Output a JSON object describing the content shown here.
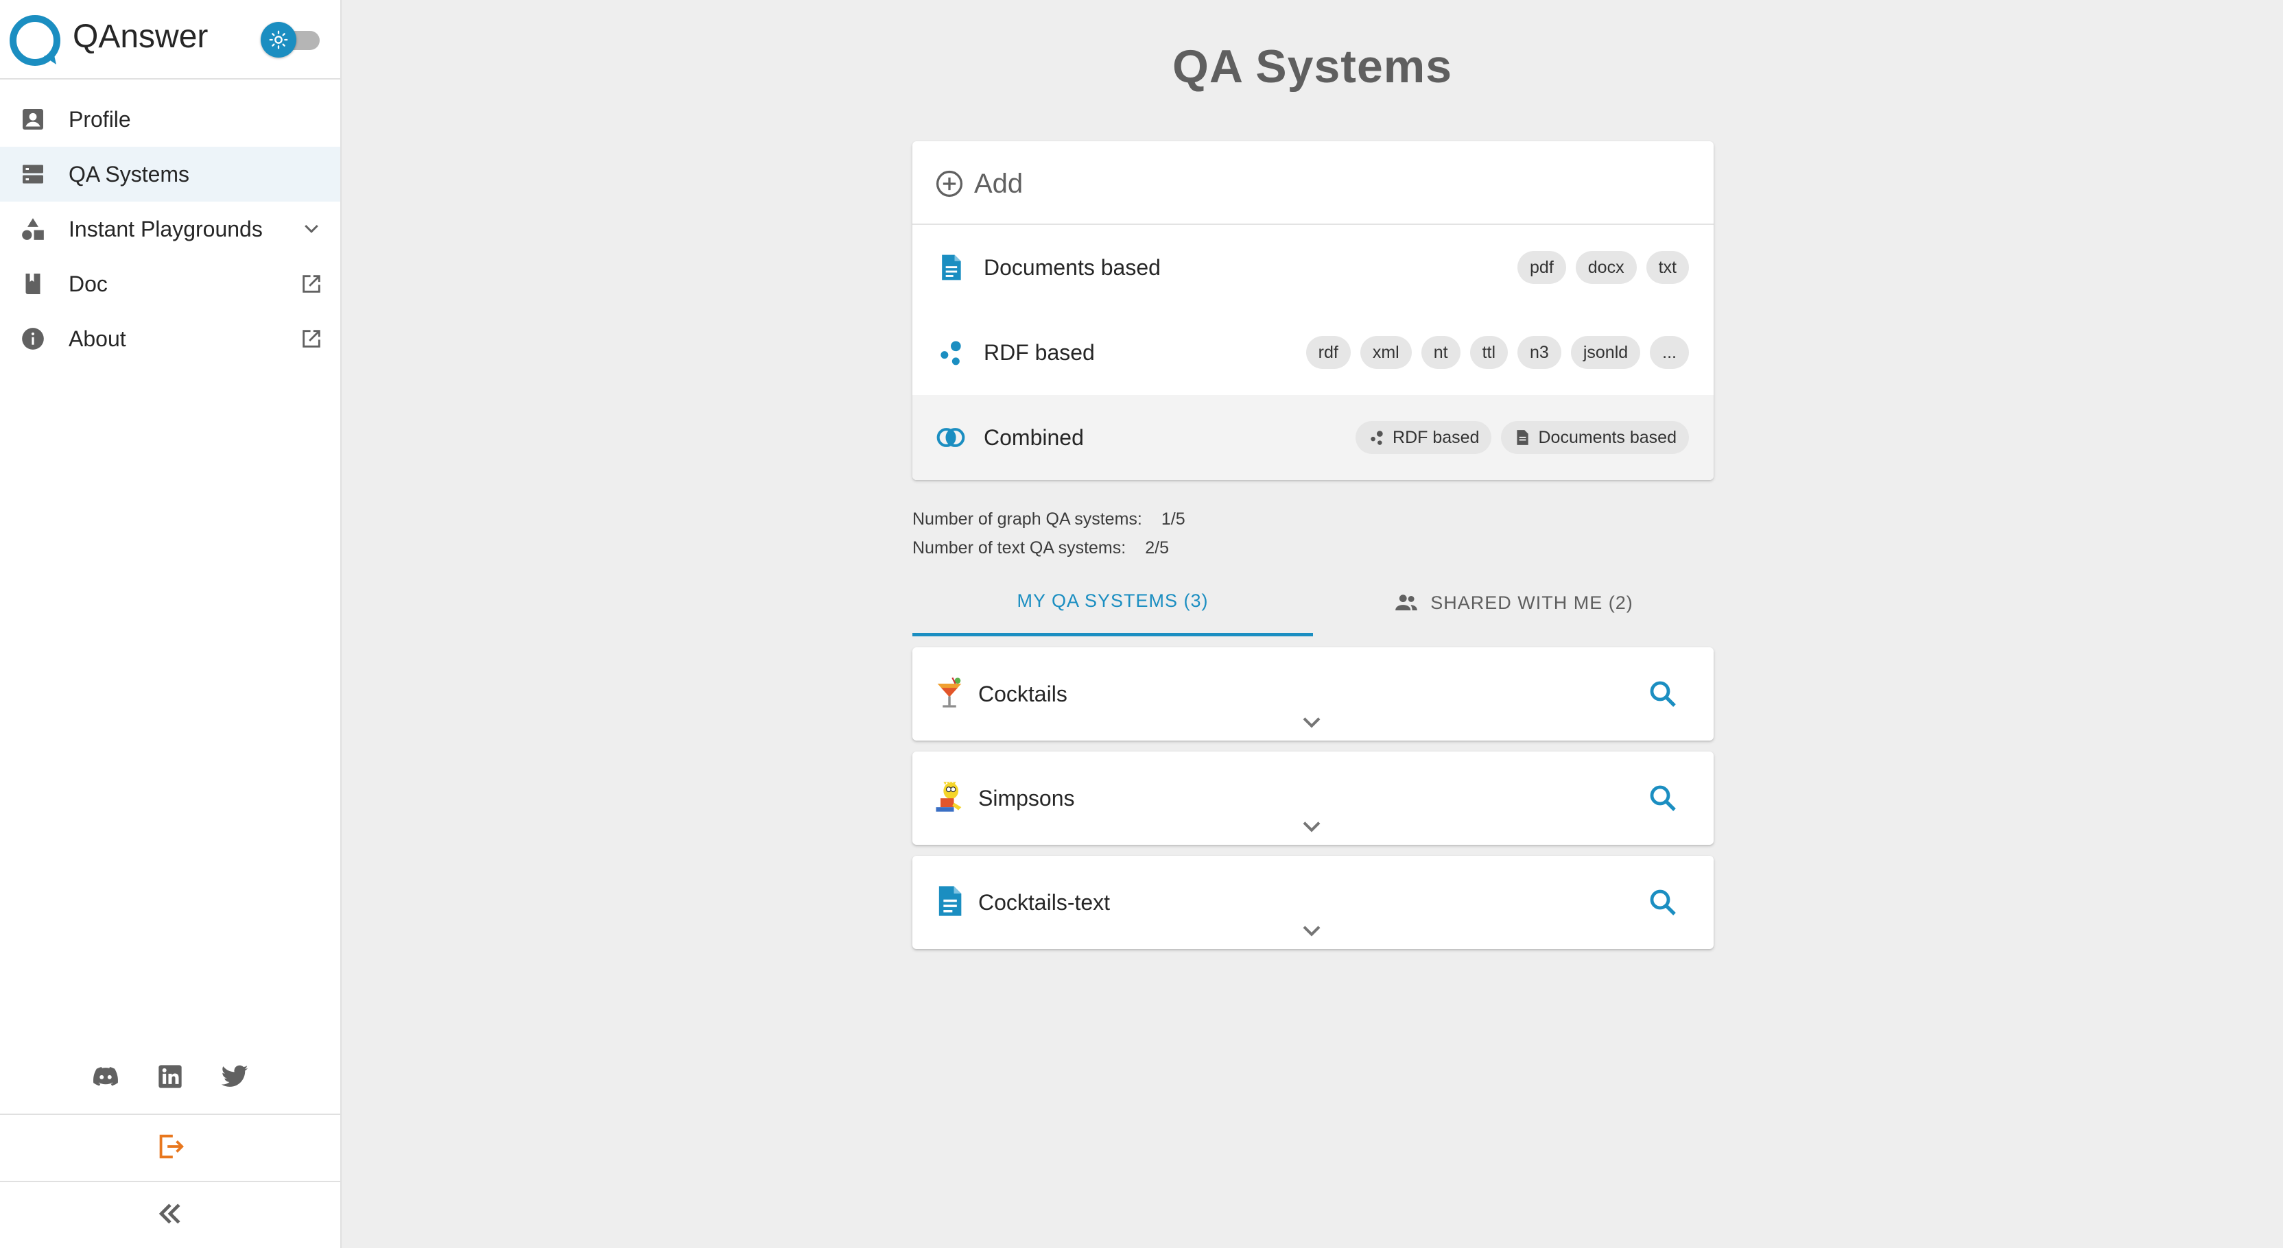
{
  "app": {
    "name": "QAnswer"
  },
  "colors": {
    "accent": "#1b8ec1",
    "logout": "#e8771e",
    "icon_gray": "#616161"
  },
  "sidebar": {
    "theme_toggle": {
      "icon": "sun-icon",
      "state": "light"
    },
    "items": [
      {
        "label": "Profile",
        "icon": "profile-icon",
        "trailing": null,
        "active": false
      },
      {
        "label": "QA Systems",
        "icon": "server-icon",
        "trailing": null,
        "active": true
      },
      {
        "label": "Instant Playgrounds",
        "icon": "shapes-icon",
        "trailing": "chevron-down-icon",
        "active": false
      },
      {
        "label": "Doc",
        "icon": "book-icon",
        "trailing": "external-link-icon",
        "active": false
      },
      {
        "label": "About",
        "icon": "info-icon",
        "trailing": "external-link-icon",
        "active": false
      }
    ],
    "socials": [
      "discord-icon",
      "linkedin-icon",
      "twitter-icon"
    ],
    "logout_icon": "logout-icon",
    "collapse_icon": "double-chevron-left-icon"
  },
  "main": {
    "title": "QA Systems",
    "add": {
      "label": "Add",
      "types": [
        {
          "label": "Documents based",
          "icon": "document-icon",
          "chips": [
            "pdf",
            "docx",
            "txt"
          ]
        },
        {
          "label": "RDF based",
          "icon": "rdf-icon",
          "chips": [
            "rdf",
            "xml",
            "nt",
            "ttl",
            "n3",
            "jsonld",
            "..."
          ]
        },
        {
          "label": "Combined",
          "icon": "combined-icon",
          "chips": [
            "RDF based",
            "Documents based"
          ]
        }
      ]
    },
    "stats": {
      "graph_label": "Number of graph QA systems:",
      "graph_value": "1/5",
      "text_label": "Number of text QA systems:",
      "text_value": "2/5"
    },
    "tabs": {
      "my": "MY QA SYSTEMS (3)",
      "shared": "SHARED WITH ME (2)"
    },
    "systems": [
      {
        "name": "Cocktails",
        "icon": "cocktail-icon"
      },
      {
        "name": "Simpsons",
        "icon": "simpsons-icon"
      },
      {
        "name": "Cocktails-text",
        "icon": "document-icon"
      }
    ]
  }
}
